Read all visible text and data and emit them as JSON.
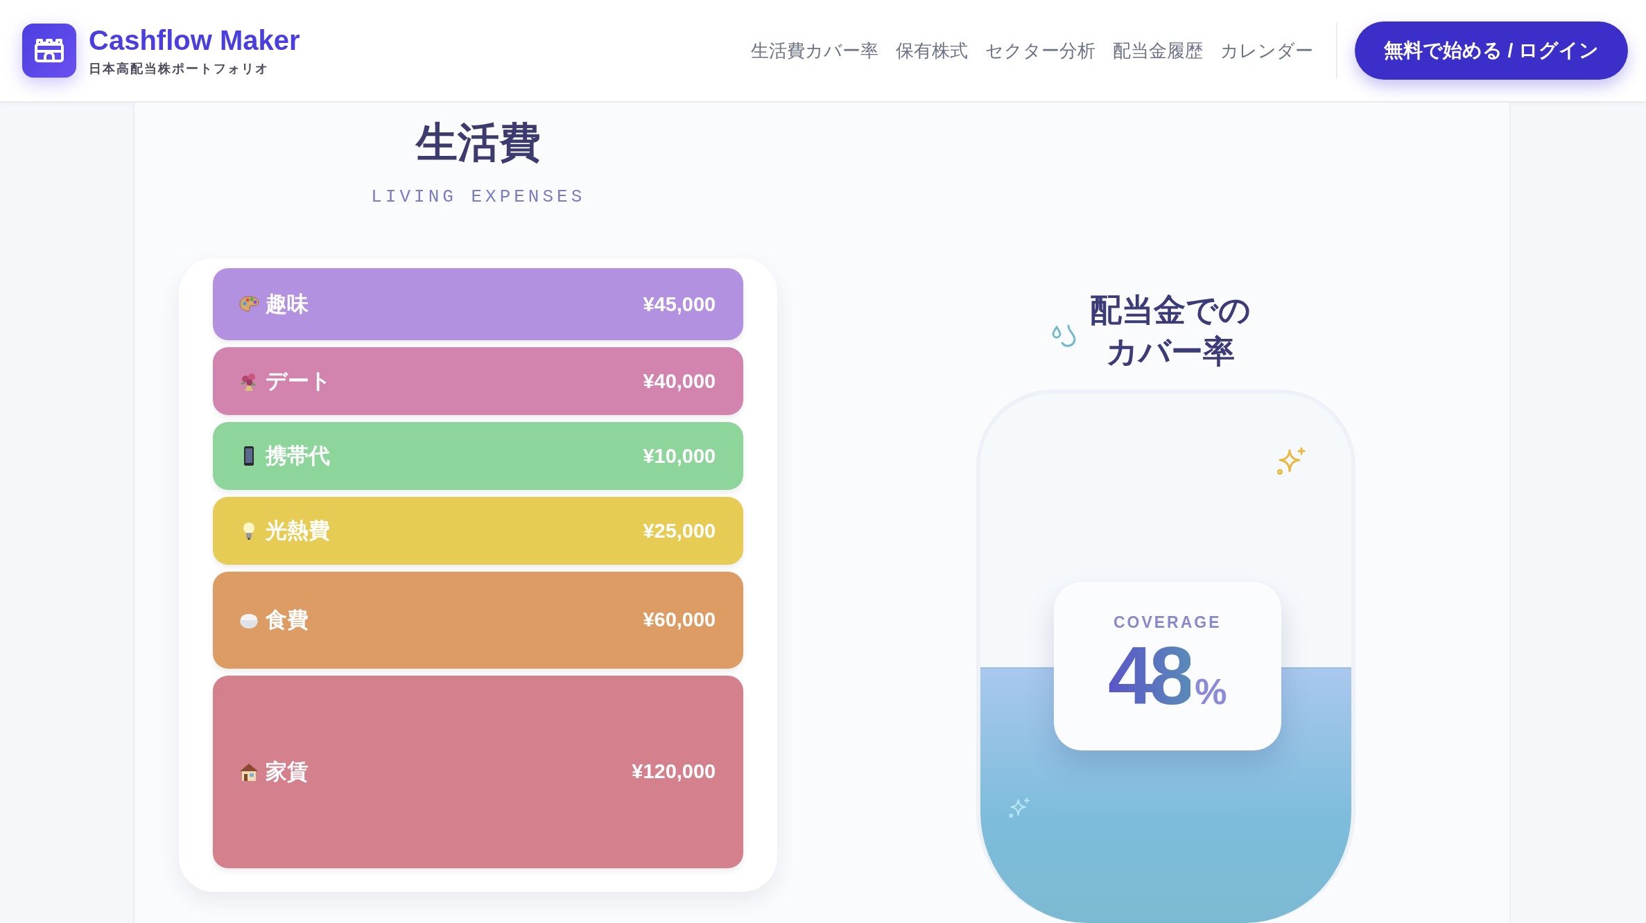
{
  "header": {
    "brand": "Cashflow Maker",
    "tagline": "日本高配当株ポートフォリオ",
    "nav": [
      {
        "label": "生活費カバー率"
      },
      {
        "label": "保有株式"
      },
      {
        "label": "セクター分析"
      },
      {
        "label": "配当金履歴"
      },
      {
        "label": "カレンダー"
      }
    ],
    "cta": "無料で始める / ログイン"
  },
  "expenses": {
    "title": "生活費",
    "subtitle": "LIVING EXPENSES",
    "items": [
      {
        "label": "趣味",
        "amount": "¥45,000",
        "color": "#b291e0"
      },
      {
        "label": "デート",
        "amount": "¥40,000",
        "color": "#d283ae"
      },
      {
        "label": "携帯代",
        "amount": "¥10,000",
        "color": "#8dd59a"
      },
      {
        "label": "光熱費",
        "amount": "¥25,000",
        "color": "#e6cc55"
      },
      {
        "label": "食費",
        "amount": "¥60,000",
        "color": "#dd9c64"
      },
      {
        "label": "家賃",
        "amount": "¥120,000",
        "color": "#d5818d"
      }
    ]
  },
  "coverage": {
    "title": "配当金でのカバー率",
    "caption": "COVERAGE",
    "value": "48",
    "unit": "%",
    "level": 0.48
  }
}
